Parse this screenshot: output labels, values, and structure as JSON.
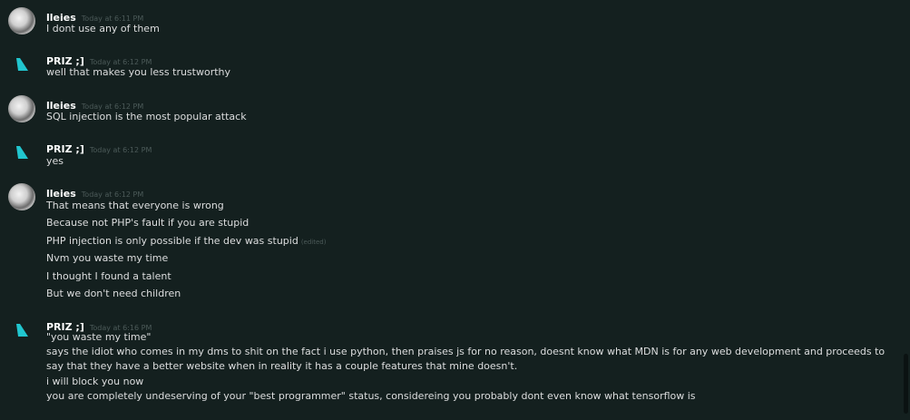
{
  "colors": {
    "background": "#14201f",
    "text": "#dcddde",
    "username": "#ffffff",
    "timestamp": "#4c5a59",
    "priz_avatar": "#21c6cf"
  },
  "messages": [
    {
      "author": "lleies",
      "avatar_icon": "grayscale-photo-avatar",
      "timestamp": "Today at 6:11 PM",
      "lines": [
        "I dont use any of them"
      ]
    },
    {
      "author": "PRIZ ;]",
      "avatar_icon": "cyan-flag-avatar",
      "timestamp": "Today at 6:12 PM",
      "lines": [
        "well that makes you less trustworthy"
      ]
    },
    {
      "author": "lleies",
      "avatar_icon": "grayscale-photo-avatar",
      "timestamp": "Today at 6:12 PM",
      "lines": [
        "SQL injection is the most popular attack"
      ]
    },
    {
      "author": "PRIZ ;]",
      "avatar_icon": "cyan-flag-avatar",
      "timestamp": "Today at 6:12 PM",
      "lines": [
        "yes"
      ]
    },
    {
      "author": "lleies",
      "avatar_icon": "grayscale-photo-avatar",
      "timestamp": "Today at 6:12 PM",
      "lines": [
        "That means that everyone is wrong",
        "Because not PHP's fault if you are stupid",
        "PHP injection is only possible if the dev was stupid",
        "Nvm you waste my time",
        "I thought I found a talent",
        "But we don't need children"
      ],
      "edited_label": "(edited)"
    },
    {
      "author": "PRIZ ;]",
      "avatar_icon": "cyan-flag-avatar",
      "timestamp": "Today at 6:16 PM",
      "lines": [
        "\"you waste my time\"",
        "says the idiot who comes in my dms to shit on the fact i use python, then praises js for no reason, doesnt know what MDN is for any web development and proceeds to say that they have a better website when in reality it has a couple features that mine doesn't.",
        "i will block you now",
        "you are completely undeserving of your \"best programmer\" status, considereing you probably dont even know what tensorflow is"
      ]
    }
  ]
}
